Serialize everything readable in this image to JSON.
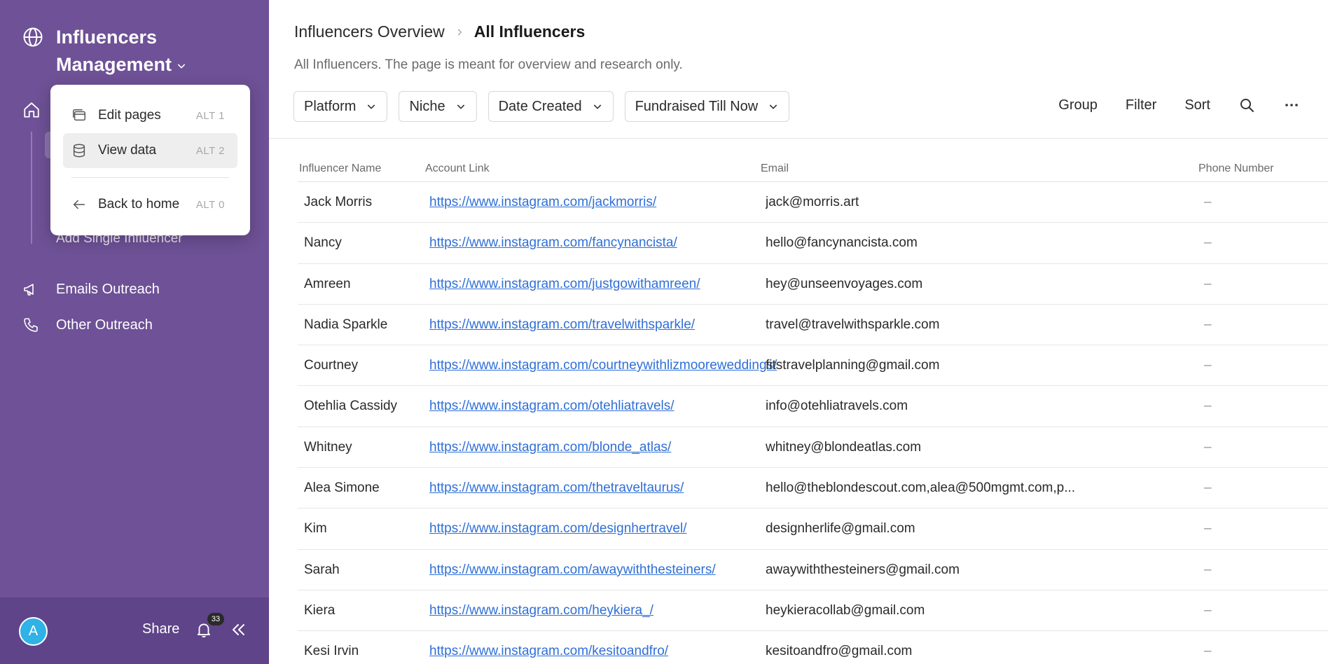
{
  "sidebar": {
    "app_title_line1": "Influencers",
    "app_title_line2": "Management",
    "nav_sub_item": "Add Single Influencer",
    "nav_items": [
      {
        "label": "Emails Outreach",
        "icon": "megaphone-icon"
      },
      {
        "label": "Other Outreach",
        "icon": "phone-icon"
      }
    ],
    "footer": {
      "avatar_initial": "A",
      "share_label": "Share",
      "notifications_count": "33"
    }
  },
  "menu": {
    "items": [
      {
        "label": "Edit pages",
        "shortcut": "ALT  1",
        "icon": "pages-icon"
      },
      {
        "label": "View data",
        "shortcut": "ALT  2",
        "icon": "database-icon"
      },
      {
        "label": "Back to home",
        "shortcut": "ALT  0",
        "icon": "arrow-left-icon"
      }
    ]
  },
  "header": {
    "breadcrumb_parent": "Influencers Overview",
    "breadcrumb_current": "All Influencers",
    "subtitle": "All Influencers. The page is meant for overview and research only."
  },
  "filters": [
    "Platform",
    "Niche",
    "Date Created",
    "Fundraised Till Now"
  ],
  "toolbar": {
    "group": "Group",
    "filter": "Filter",
    "sort": "Sort"
  },
  "table": {
    "columns": [
      "Influencer Name",
      "Account Link",
      "Email",
      "Phone Number"
    ],
    "rows": [
      {
        "name": "Jack Morris",
        "link": "https://www.instagram.com/jackmorris/",
        "email": "jack@morris.art",
        "phone": "–"
      },
      {
        "name": "Nancy",
        "link": "https://www.instagram.com/fancynancista/",
        "email": "hello@fancynancista.com",
        "phone": "–"
      },
      {
        "name": "Amreen",
        "link": "https://www.instagram.com/justgowithamreen/",
        "email": "hey@unseenvoyages.com",
        "phone": "–"
      },
      {
        "name": "Nadia Sparkle",
        "link": "https://www.instagram.com/travelwithsparkle/",
        "email": "travel@travelwithsparkle.com",
        "phone": "–"
      },
      {
        "name": "Courtney",
        "link": "https://www.instagram.com/courtneywithlizmooreweddings/",
        "email": "fitstravelplanning@gmail.com",
        "phone": "–"
      },
      {
        "name": "Otehlia Cassidy",
        "link": "https://www.instagram.com/otehliatravels/",
        "email": "info@otehliatravels.com",
        "phone": "–"
      },
      {
        "name": "Whitney",
        "link": "https://www.instagram.com/blonde_atlas/",
        "email": "whitney@blondeatlas.com",
        "phone": "–"
      },
      {
        "name": "Alea Simone",
        "link": "https://www.instagram.com/thetraveltaurus/",
        "email": "hello@theblondescout.com,alea@500mgmt.com,p...",
        "phone": "–"
      },
      {
        "name": "Kim",
        "link": "https://www.instagram.com/designhertravel/",
        "email": "designherlife@gmail.com",
        "phone": "–"
      },
      {
        "name": "Sarah",
        "link": "https://www.instagram.com/awaywiththesteiners/",
        "email": "awaywiththesteiners@gmail.com",
        "phone": "–"
      },
      {
        "name": "Kiera",
        "link": "https://www.instagram.com/heykiera_/",
        "email": "heykieracollab@gmail.com",
        "phone": "–"
      },
      {
        "name": "Kesi Irvin",
        "link": "https://www.instagram.com/kesitoandfro/",
        "email": "kesitoandfro@gmail.com",
        "phone": "–"
      }
    ]
  },
  "colors": {
    "sidebar_bg": "#6e5196",
    "link": "#2f6fd6",
    "avatar": "#2fb2e6"
  }
}
